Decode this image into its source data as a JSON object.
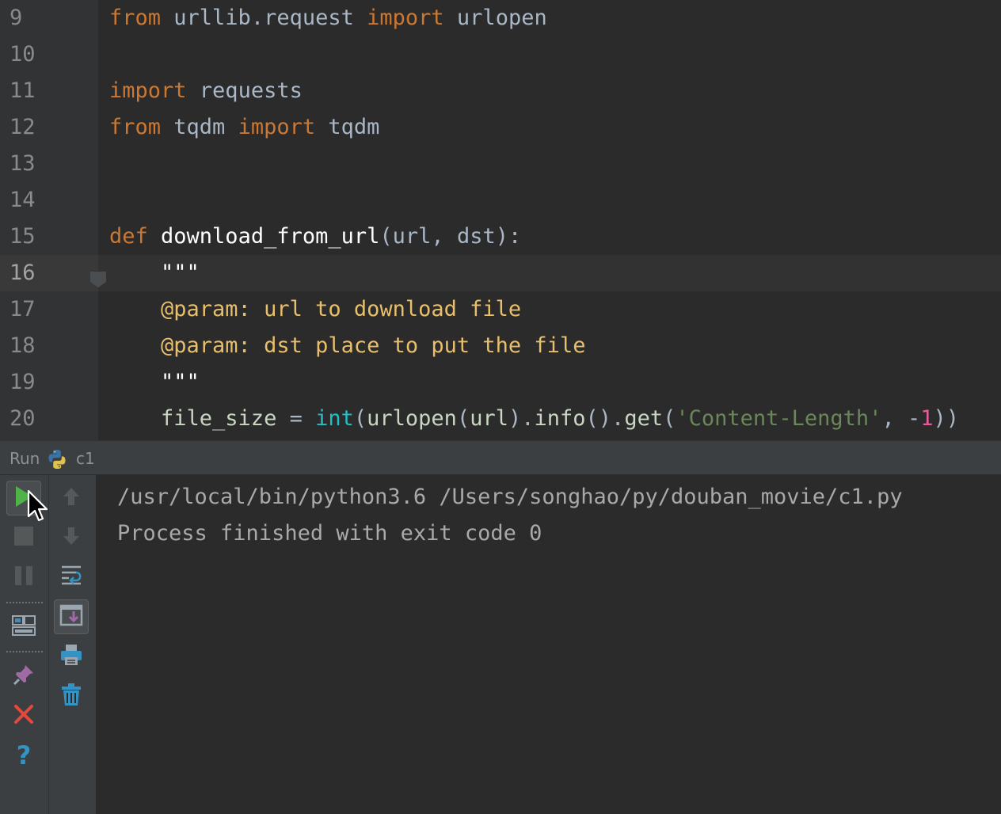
{
  "editor": {
    "lines": [
      {
        "n": "9",
        "tokens": [
          [
            "kw",
            "from "
          ],
          [
            "mod",
            "urllib.request "
          ],
          [
            "kw",
            "import "
          ],
          [
            "mod",
            "urlopen"
          ]
        ]
      },
      {
        "n": "10",
        "tokens": []
      },
      {
        "n": "11",
        "tokens": [
          [
            "kw",
            "import "
          ],
          [
            "mod",
            "requests"
          ]
        ]
      },
      {
        "n": "12",
        "tokens": [
          [
            "kw",
            "from "
          ],
          [
            "mod",
            "tqdm "
          ],
          [
            "kw",
            "import "
          ],
          [
            "mod",
            "tqdm"
          ]
        ]
      },
      {
        "n": "13",
        "tokens": []
      },
      {
        "n": "14",
        "tokens": []
      },
      {
        "n": "15",
        "tokens": [
          [
            "kw",
            "def "
          ],
          [
            "fn",
            "download_from_url"
          ],
          [
            "pun",
            "("
          ],
          [
            "prm",
            "url"
          ],
          [
            "pun",
            ", "
          ],
          [
            "prm",
            "dst"
          ],
          [
            "pun",
            "):"
          ]
        ]
      },
      {
        "n": "16",
        "tokens": [
          [
            "docq",
            "    \"\"\""
          ]
        ],
        "current": true
      },
      {
        "n": "17",
        "tokens": [
          [
            "doc",
            "    @param: url to download file"
          ]
        ]
      },
      {
        "n": "18",
        "tokens": [
          [
            "doc",
            "    @param: dst place to put the file"
          ]
        ]
      },
      {
        "n": "19",
        "tokens": [
          [
            "docq",
            "    \"\"\""
          ]
        ]
      },
      {
        "n": "20",
        "tokens": [
          [
            "idt",
            "    file_size "
          ],
          [
            "pun",
            "= "
          ],
          [
            "bi",
            "int"
          ],
          [
            "pun",
            "("
          ],
          [
            "idt",
            "urlopen"
          ],
          [
            "pun",
            "("
          ],
          [
            "idt",
            "url"
          ],
          [
            "pun",
            ")."
          ],
          [
            "idt",
            "info"
          ],
          [
            "pun",
            "()."
          ],
          [
            "idt",
            "get"
          ],
          [
            "pun",
            "("
          ],
          [
            "str",
            "'Content-Length'"
          ],
          [
            "pun",
            ", -"
          ],
          [
            "num",
            "1"
          ],
          [
            "pun",
            "))"
          ]
        ]
      }
    ]
  },
  "run_panel": {
    "title": "Run",
    "config_name": "c1",
    "console": [
      "/usr/local/bin/python3.6 /Users/songhao/py/douban_movie/c1.py",
      "",
      "Process finished with exit code 0"
    ]
  },
  "icons": {
    "rerun": "run-play-icon",
    "stop": "stop-icon",
    "pause": "pause-icon",
    "restore_layout": "restore-layout-icon",
    "pin": "pin-icon",
    "close": "close-icon",
    "help": "help-icon",
    "up": "arrow-up-icon",
    "down": "arrow-down-icon",
    "soft_wrap": "soft-wrap-icon",
    "scroll_to_end": "scroll-to-end-icon",
    "print": "print-icon",
    "clear": "trash-icon"
  },
  "colors": {
    "keyword": "#cc7832",
    "docstring": "#e8bf6a",
    "string": "#6a8759",
    "builtin": "#22c0c5",
    "number": "#e45c9a",
    "run_green": "#4fb34a",
    "close_red": "#e5493d",
    "help_blue": "#3592c4"
  }
}
